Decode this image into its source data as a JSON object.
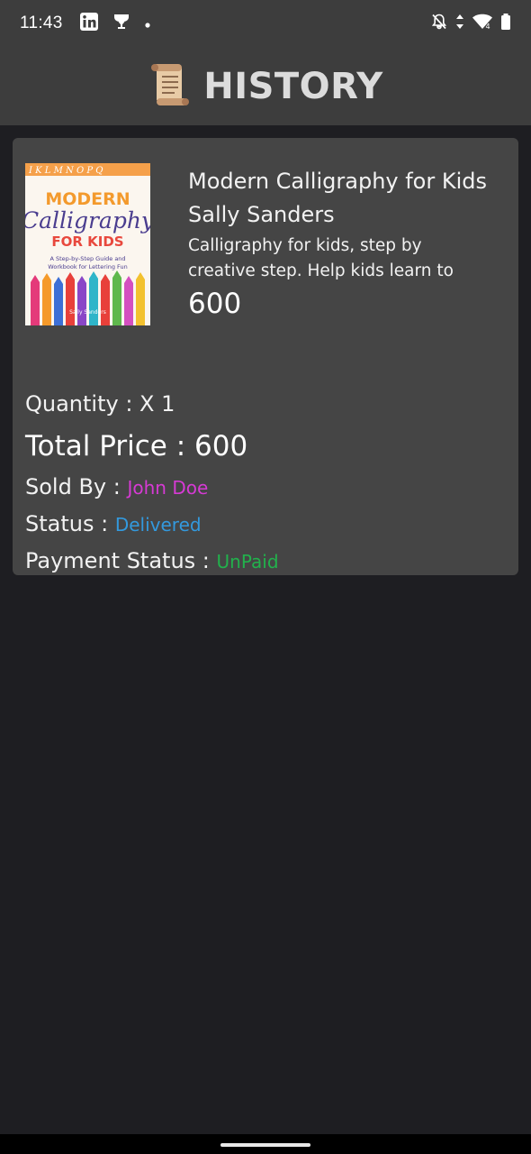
{
  "status_bar": {
    "time": "11:43",
    "left_icons": [
      "linkedin-icon",
      "trophy-icon",
      "dot-icon"
    ],
    "right_icons": [
      "bell-off-icon",
      "data-arrows-icon",
      "wifi-icon",
      "battery-icon"
    ]
  },
  "header": {
    "icon": "scroll-icon",
    "title": "HISTORY"
  },
  "order": {
    "cover": {
      "strip": "I K L M N O P Q",
      "line1": "MODERN",
      "line2": "Calligraphy",
      "line3": "FOR KIDS",
      "subtitle_a": "A Step-by-Step Guide and",
      "subtitle_b": "Workbook for Lettering Fun",
      "author": "Sally Sanders"
    },
    "title": "Modern Calligraphy for Kids",
    "author": "Sally Sanders",
    "description": "Calligraphy for kids, step by creative step. Help kids learn to",
    "price": "600",
    "quantity_label": "Quantity : X 1",
    "total_label": "Total Price : 600",
    "sold_by_label": "Sold By : ",
    "seller": "John Doe",
    "status_label": "Status : ",
    "status": "Delivered",
    "payment_label": "Payment Status : ",
    "payment_status": "UnPaid"
  },
  "colors": {
    "seller": "#d63ad4",
    "status": "#3399dd",
    "payment": "#22b14c",
    "bar": "#3d3d3d",
    "background": "#1e1e22",
    "card": "#454545"
  }
}
